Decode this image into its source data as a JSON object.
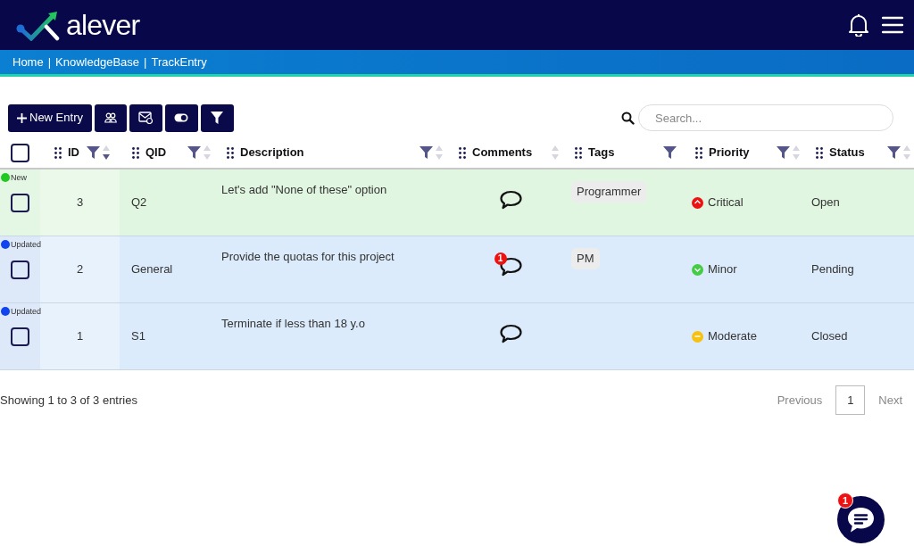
{
  "header": {
    "logo_text": "alever"
  },
  "breadcrumb": {
    "separator": "|",
    "items": [
      "Home",
      "KnowledgeBase",
      "TrackEntry"
    ]
  },
  "toolbar": {
    "new_button": "New Entry",
    "icon_buttons": [
      {
        "kind": "users"
      },
      {
        "kind": "mail"
      },
      {
        "kind": "toggle"
      },
      {
        "kind": "filter"
      }
    ]
  },
  "search": {
    "placeholder": "Search..."
  },
  "table": {
    "select_all": {
      "checked": false
    },
    "columns": [
      {
        "label": "ID",
        "filter": true,
        "sortable": true,
        "sorted_descending": true
      },
      {
        "label": "QID",
        "filter": true,
        "sortable": true,
        "sorted_descending": false
      },
      {
        "label": "Description",
        "filter": true,
        "sortable": true,
        "sorted_descending": false
      },
      {
        "label": "Comments",
        "filter": false,
        "sortable": true,
        "sorted_descending": false
      },
      {
        "label": "Tags",
        "filter": true,
        "sortable": false
      },
      {
        "label": "Priority",
        "filter": true,
        "sortable": true,
        "sorted_descending": false
      },
      {
        "label": "Status",
        "filter": true,
        "sortable": true,
        "sorted_descending": false
      }
    ],
    "rows": [
      {
        "marker": {
          "kind": "new",
          "label": "New",
          "color": "#22c922"
        },
        "checked": false,
        "id": "3",
        "qid": "Q2",
        "description": "Let's add \"None of these\" option",
        "comment_badge": null,
        "tags": [
          "Programmer"
        ],
        "priority": {
          "kind": "up",
          "label": "Critical",
          "color": "#ee1111"
        },
        "status": "Open"
      },
      {
        "marker": {
          "kind": "updated",
          "label": "Updated",
          "color": "#1144ee"
        },
        "checked": false,
        "id": "2",
        "qid": "General",
        "description": "Provide the quotas for this project",
        "comment_badge": "1",
        "tags": [
          "PM"
        ],
        "priority": {
          "kind": "down",
          "label": "Minor",
          "color": "#44cc44"
        },
        "status": "Pending"
      },
      {
        "marker": {
          "kind": "updated",
          "label": "Updated",
          "color": "#1144ee"
        },
        "checked": false,
        "id": "1",
        "qid": "S1",
        "description": "Terminate if less than 18 y.o",
        "comment_badge": null,
        "tags": [],
        "priority": {
          "kind": "flat",
          "label": "Moderate",
          "color": "#f5c211"
        },
        "status": "Closed"
      }
    ]
  },
  "footer": {
    "info": "Showing 1 to 3 of 3 entries",
    "previous": "Previous",
    "pages": [
      {
        "label": "1",
        "selected": true
      }
    ],
    "next": "Next"
  },
  "chat": {
    "badge": "1"
  }
}
